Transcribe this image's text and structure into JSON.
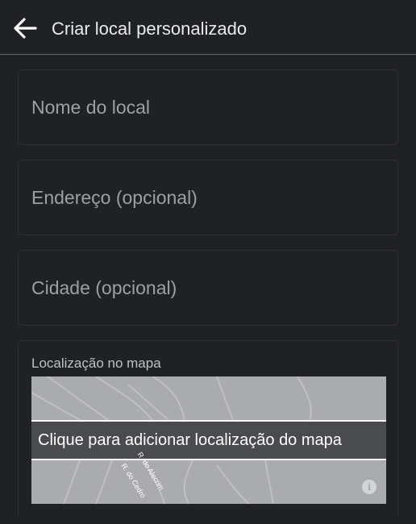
{
  "header": {
    "title": "Criar local personalizado",
    "back_icon": "arrow-left-icon"
  },
  "form": {
    "name_placeholder": "Nome do local",
    "address_placeholder": "Endereço (opcional)",
    "city_placeholder": "Cidade (opcional)",
    "name_value": "",
    "address_value": "",
    "city_value": ""
  },
  "map": {
    "label": "Localização no mapa",
    "cta": "Clique para adicionar localização do mapa",
    "streets": [
      "R. do Alecrim",
      "R. do Cedro"
    ],
    "info_glyph": "i"
  },
  "colors": {
    "background": "#202124",
    "text": "#e8eaed",
    "placeholder": "#9aa0a6",
    "map_bg": "#aaabae",
    "cta_bg": "#4a4b4e"
  }
}
